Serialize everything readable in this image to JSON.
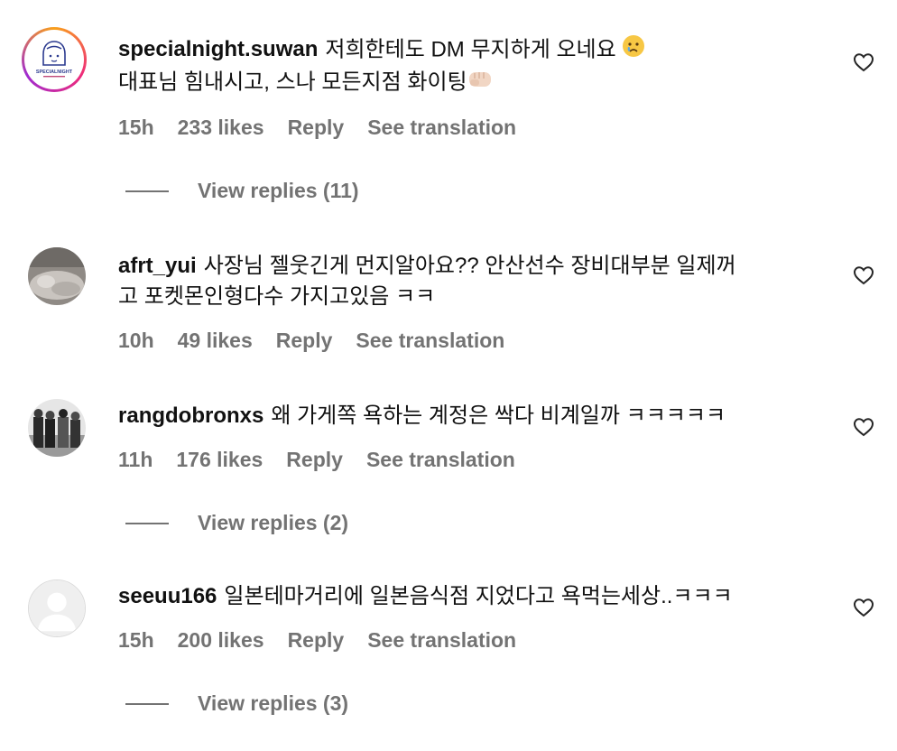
{
  "comments": [
    {
      "username": "specialnight.suwan",
      "text": "저희한테도 DM 무지하게 오네요 😢 대표님 힘내시고, 스나 모든지점 화이팅👊🏻",
      "text_line1": "저희한테도 DM 무지하게 오네요",
      "text_line2": "대표님 힘내시고, 스나 모든지점 화이팅",
      "time": "15h",
      "likes": "233 likes",
      "reply": "Reply",
      "see_translation": "See translation",
      "view_replies": "View replies (11)",
      "avatar_text": "SPECIALNIGHT",
      "icons": [
        "crying-face-emoji",
        "fist-emoji",
        "heart-icon"
      ]
    },
    {
      "username": "afrt_yui",
      "text_line1": "사장님 젤웃긴게 먼지알아요?? 안산선수 장비대부분 일제꺼",
      "text_line2": "고 포켓몬인형다수 가지고있음 ㅋㅋ",
      "time": "10h",
      "likes": "49 likes",
      "reply": "Reply",
      "see_translation": "See translation",
      "icons": [
        "heart-icon"
      ]
    },
    {
      "username": "rangdobronxs",
      "text_line1": "왜 가게쪽 욕하는 계정은 싹다 비계일까 ㅋㅋㅋㅋㅋ",
      "time": "11h",
      "likes": "176 likes",
      "reply": "Reply",
      "see_translation": "See translation",
      "view_replies": "View replies (2)",
      "icons": [
        "heart-icon"
      ]
    },
    {
      "username": "seeuu166",
      "text_line1": "일본테마거리에 일본음식점 지었다고 욕먹는세상..ㅋㅋㅋ",
      "time": "15h",
      "likes": "200 likes",
      "reply": "Reply",
      "see_translation": "See translation",
      "view_replies": "View replies (3)",
      "icons": [
        "default-avatar-icon",
        "heart-icon"
      ]
    }
  ],
  "colors": {
    "meta_text": "#737373",
    "body_text": "#111111",
    "story_ring": [
      "#f9a01b",
      "#ee2a7b",
      "#a02bd0"
    ]
  }
}
